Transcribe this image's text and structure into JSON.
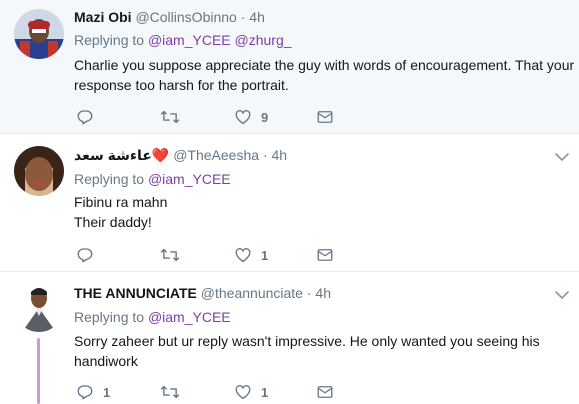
{
  "tweets": [
    {
      "name": "Mazi Obi",
      "name_suffix": "",
      "handle": "@CollinsObinno",
      "time": "4h",
      "replying_prefix": "Replying to",
      "mentions": [
        "@iam_YCEE",
        "@zhurg_"
      ],
      "lines": [
        "Charlie you suppose appreciate the guy with words of encouragement. That your",
        "response too harsh for the portrait."
      ],
      "reply_count": "",
      "retweet_count": "",
      "like_count": "9",
      "highlighted": true
    },
    {
      "name": "عاءشة سعد",
      "name_suffix": "❤️",
      "handle": "@TheAeesha",
      "time": "4h",
      "replying_prefix": "Replying to",
      "mentions": [
        "@iam_YCEE"
      ],
      "lines": [
        "Fibinu ra mahn",
        "Their daddy!"
      ],
      "reply_count": "",
      "retweet_count": "",
      "like_count": "1",
      "highlighted": false
    },
    {
      "name": "THE ANNUNCIATE",
      "name_suffix": "",
      "handle": "@theannunciate",
      "time": "4h",
      "replying_prefix": "Replying to",
      "mentions": [
        "@iam_YCEE"
      ],
      "lines": [
        "Sorry zaheer but ur reply wasn't impressive. He only wanted you seeing his",
        "handiwork"
      ],
      "reply_count": "1",
      "retweet_count": "",
      "like_count": "1",
      "highlighted": false
    }
  ],
  "icons": {
    "reply": "reply-icon",
    "retweet": "retweet-icon",
    "like": "heart-icon",
    "dm": "envelope-icon",
    "caret": "chevron-down-icon"
  },
  "colors": {
    "mention": "#7e3ea6",
    "muted": "#657786",
    "highlight_bg": "#f5f8fa",
    "thread_line": "#c89bd8"
  },
  "separators": {
    "dot": "·"
  }
}
